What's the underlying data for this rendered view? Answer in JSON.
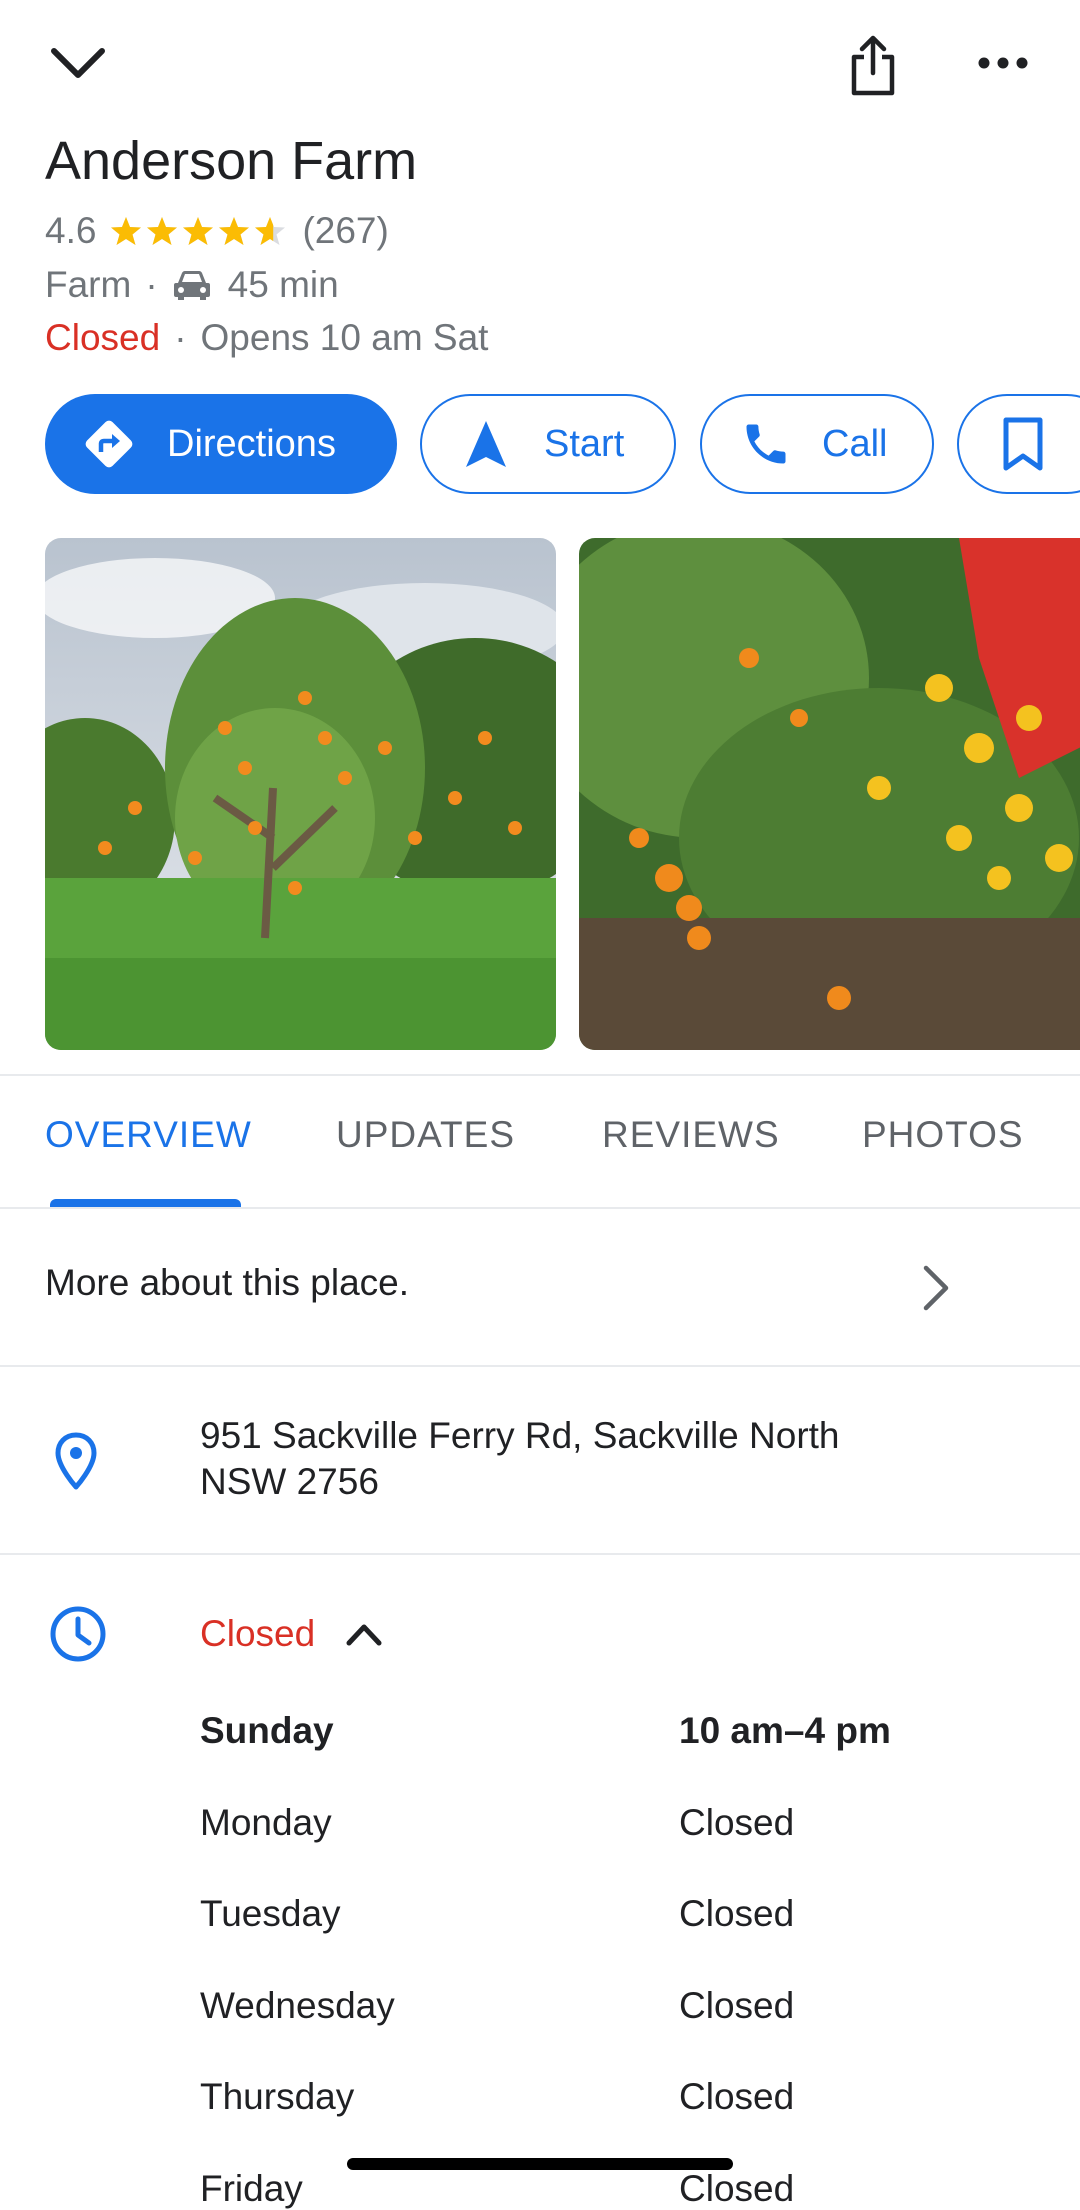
{
  "header": {
    "title": "Anderson Farm",
    "rating": "4.6",
    "star_fill": 4.6,
    "review_count": "(267)",
    "category": "Farm",
    "separator": "·",
    "drive_time": "45 min",
    "status": "Closed",
    "opens": "Opens 10 am Sat"
  },
  "actions": {
    "directions_label": "Directions",
    "start_label": "Start",
    "call_label": "Call"
  },
  "tabs": [
    {
      "label": "OVERVIEW",
      "active": true
    },
    {
      "label": "UPDATES",
      "active": false
    },
    {
      "label": "REVIEWS",
      "active": false
    },
    {
      "label": "PHOTOS",
      "active": false
    }
  ],
  "overview": {
    "more_about": "More about this place.",
    "address_line1": "951 Sackville Ferry Rd, Sackville North",
    "address_line2": "NSW 2756",
    "hours_status": "Closed",
    "hours": [
      {
        "day": "Sunday",
        "time": "10 am–4 pm",
        "today": true
      },
      {
        "day": "Monday",
        "time": "Closed",
        "today": false
      },
      {
        "day": "Tuesday",
        "time": "Closed",
        "today": false
      },
      {
        "day": "Wednesday",
        "time": "Closed",
        "today": false
      },
      {
        "day": "Thursday",
        "time": "Closed",
        "today": false
      },
      {
        "day": "Friday",
        "time": "Closed",
        "today": false
      }
    ]
  },
  "colors": {
    "accent": "#1a73e8",
    "closed_red": "#d93025",
    "star": "#fbbc04",
    "secondary_text": "#70757a"
  },
  "icons": {
    "collapse": "chevron-down-icon",
    "share": "share-icon",
    "more": "more-horizontal-icon",
    "car": "car-icon",
    "directions": "directions-icon",
    "start": "navigation-arrow-icon",
    "call": "phone-icon",
    "save": "bookmark-icon",
    "location": "location-pin-icon",
    "clock": "clock-icon",
    "expand": "chevron-up-icon",
    "more_arrow": "chevron-right-icon"
  }
}
